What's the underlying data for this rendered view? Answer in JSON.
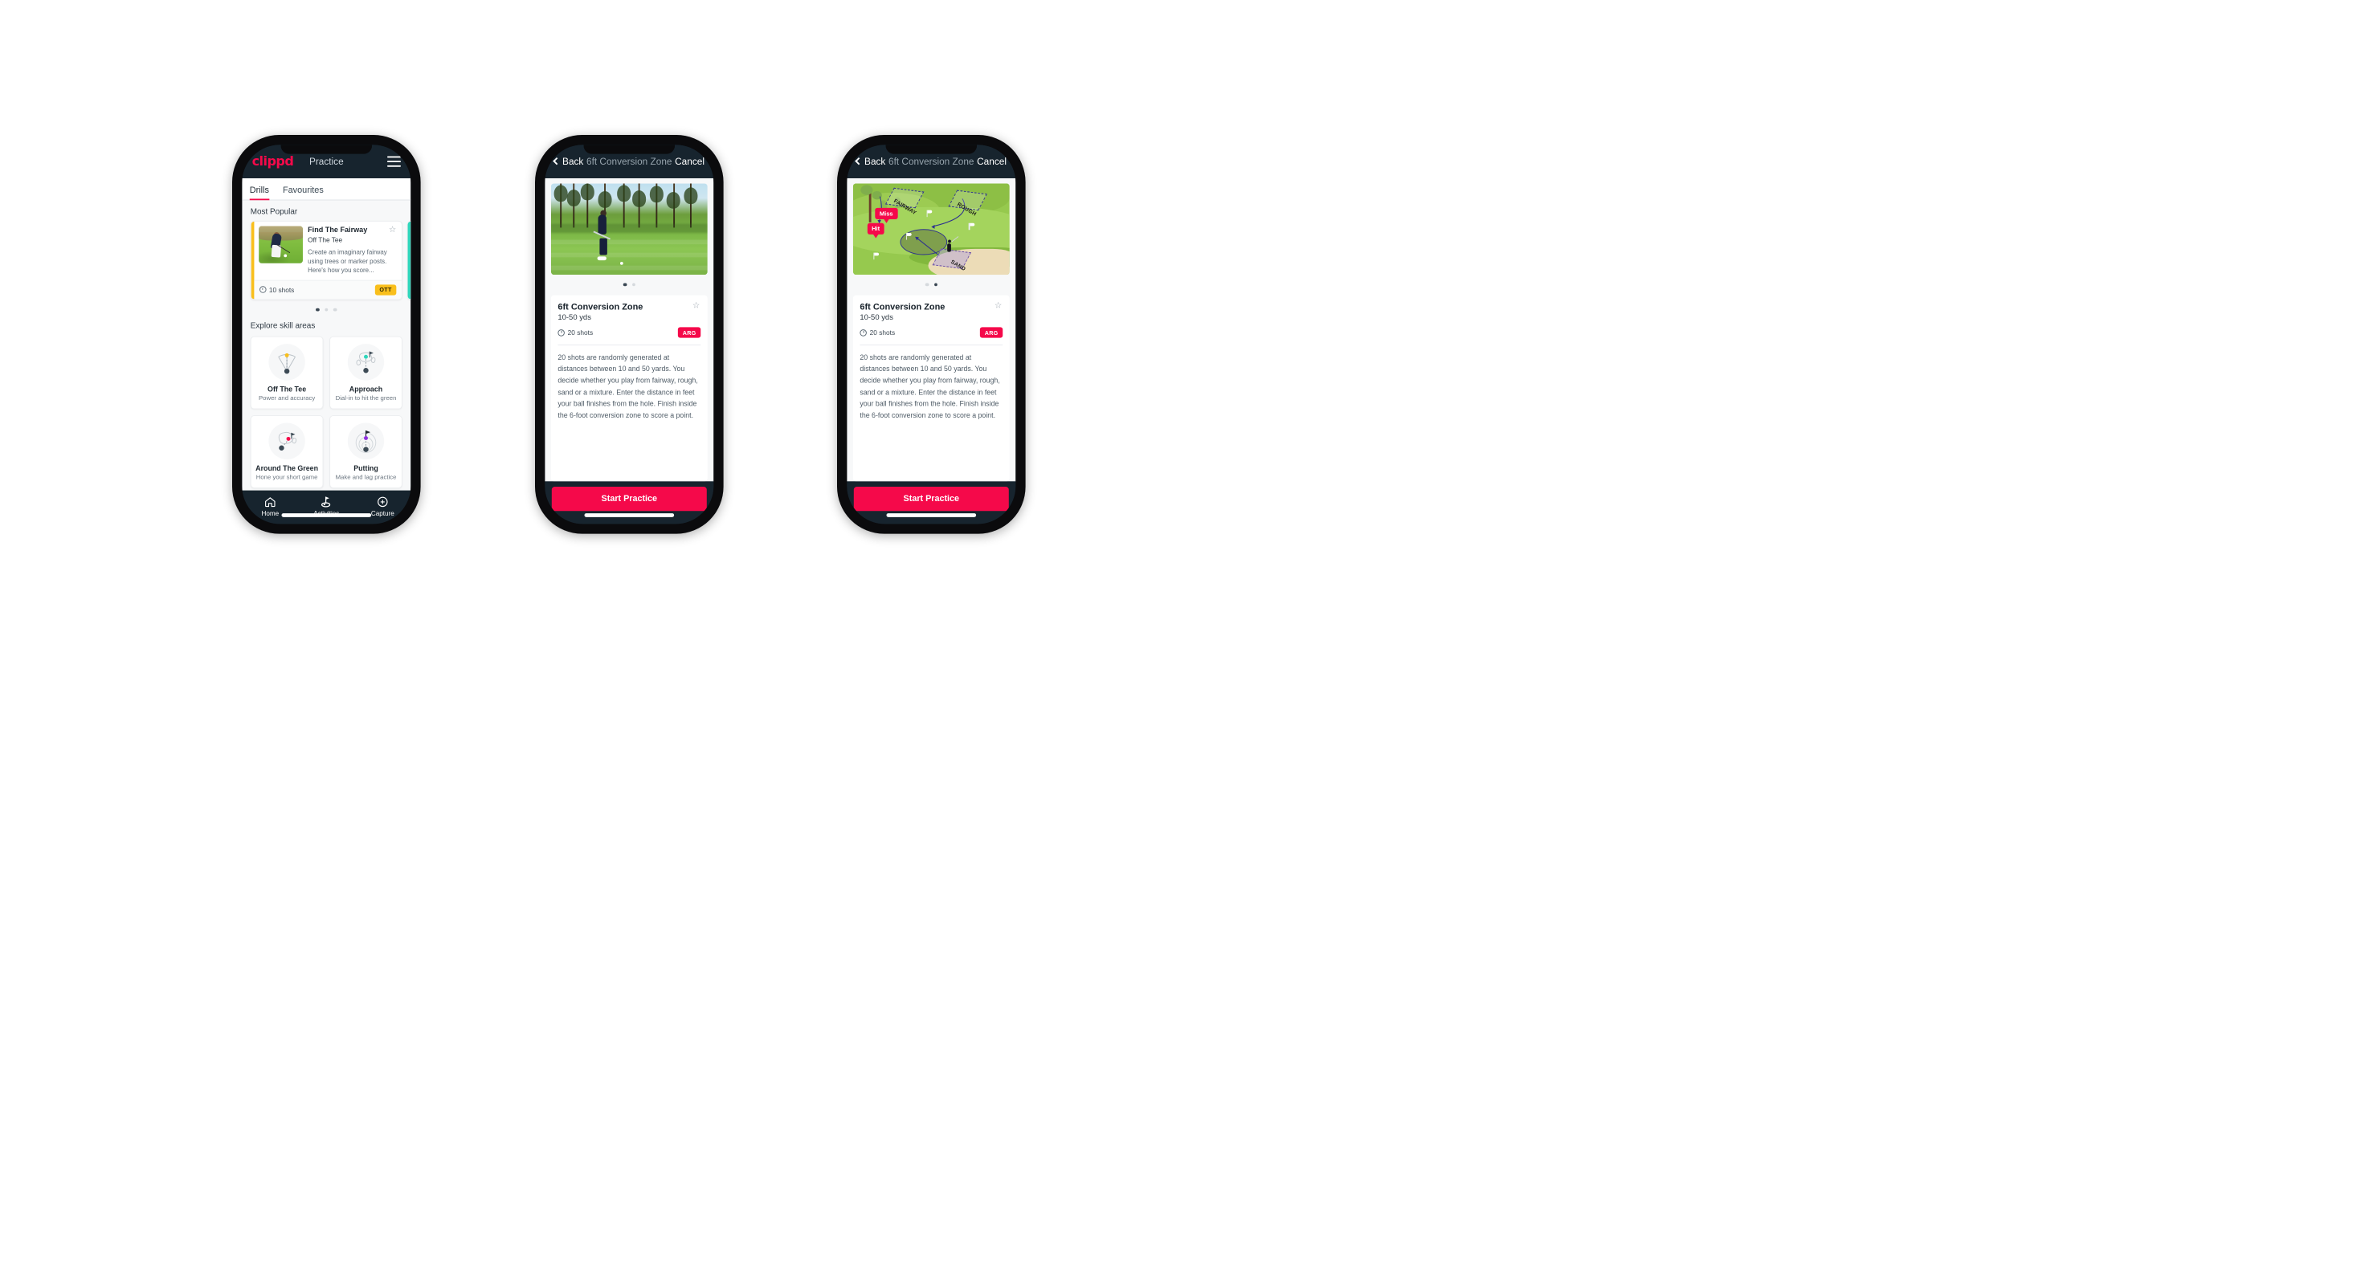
{
  "app": {
    "brand": "clippd",
    "accent_pink": "#f5094a",
    "accent_amber": "#f9bf1c",
    "accent_teal": "#2fd6bb",
    "dark_navy": "#17242e"
  },
  "screen_practice": {
    "appbar": {
      "logo": "clippd",
      "title": "Practice",
      "menu_icon": "hamburger-menu-icon"
    },
    "tabs": [
      {
        "label": "Drills",
        "active": true
      },
      {
        "label": "Favourites",
        "active": false
      }
    ],
    "most_popular": {
      "section_label": "Most Popular",
      "cards": [
        {
          "title": "Find The Fairway",
          "subtitle": "Off The Tee",
          "description": "Create an imaginary fairway using trees or marker posts. Here's how you score...",
          "shots": "10 shots",
          "badge": "OTT",
          "badge_color": "#f9bf1c",
          "accent_color": "#f9bf1c",
          "favourite": false
        }
      ],
      "dots": [
        true,
        false,
        false
      ]
    },
    "explore": {
      "section_label": "Explore skill areas",
      "cards": [
        {
          "name": "Off The Tee",
          "desc": "Power and accuracy",
          "icon": "tee-dispersion-icon",
          "dot_color": "#f9bf1c"
        },
        {
          "name": "Approach",
          "desc": "Dial-in to hit the green",
          "icon": "approach-green-icon",
          "dot_color": "#2fd6bb"
        },
        {
          "name": "Around The Green",
          "desc": "Hone your short game",
          "icon": "chip-green-icon",
          "dot_color": "#f5094a"
        },
        {
          "name": "Putting",
          "desc": "Make and lag practice",
          "icon": "putting-rings-icon",
          "dot_color": "#8e2ede"
        }
      ]
    },
    "bottom_nav": [
      {
        "label": "Home",
        "icon": "home-icon",
        "active": false
      },
      {
        "label": "Activities",
        "icon": "golf-green-flag-icon",
        "active": true
      },
      {
        "label": "Capture",
        "icon": "plus-circle-icon",
        "active": false
      }
    ]
  },
  "screen_detail": {
    "navbar": {
      "back_label": "Back",
      "title": "6ft Conversion Zone",
      "cancel_label": "Cancel",
      "back_icon": "chevron-left-icon"
    },
    "media": {
      "type": "video-thumbnail",
      "alt": "Golfer chipping on fairway with pine trees"
    },
    "dots": [
      true,
      false
    ],
    "card": {
      "title": "6ft Conversion Zone",
      "distance": "10-50 yds",
      "shots": "20 shots",
      "badge": "ARG",
      "badge_color": "#f5094a",
      "favourite": false,
      "description": "20 shots are randomly generated at distances between 10 and 50 yards. You decide whether you play from fairway, rough, sand or a mixture. Enter the distance in feet your ball finishes from the hole. Finish inside the 6-foot conversion zone to score a point."
    },
    "cta": "Start Practice"
  },
  "screen_diagram": {
    "navbar": {
      "back_label": "Back",
      "title": "6ft Conversion Zone",
      "cancel_label": "Cancel",
      "back_icon": "chevron-left-icon"
    },
    "media": {
      "type": "course-diagram",
      "labels": [
        "FAIRWAY",
        "ROUGH",
        "SAND"
      ],
      "callouts": [
        "Miss",
        "Hit"
      ]
    },
    "dots": [
      false,
      true
    ],
    "card": {
      "title": "6ft Conversion Zone",
      "distance": "10-50 yds",
      "shots": "20 shots",
      "badge": "ARG",
      "badge_color": "#f5094a",
      "favourite": false,
      "description": "20 shots are randomly generated at distances between 10 and 50 yards. You decide whether you play from fairway, rough, sand or a mixture. Enter the distance in feet your ball finishes from the hole. Finish inside the 6-foot conversion zone to score a point."
    },
    "cta": "Start Practice"
  }
}
